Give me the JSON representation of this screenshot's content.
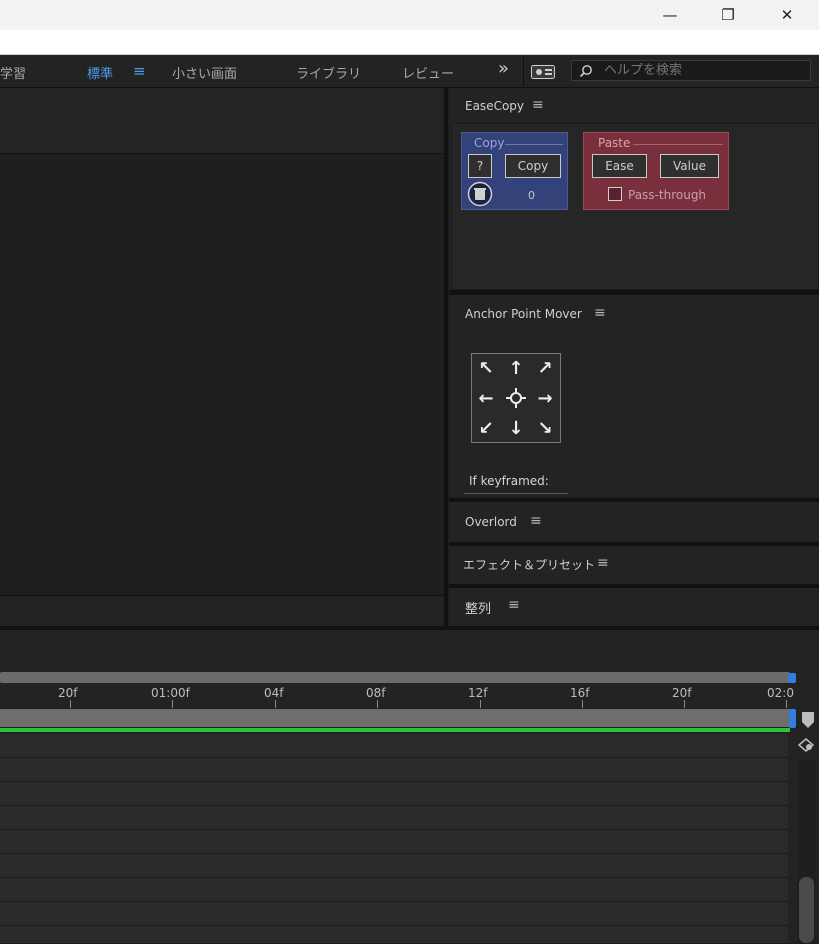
{
  "window": {
    "minimize_glyph": "—",
    "restore_glyph": "❐",
    "close_glyph": "✕"
  },
  "workspaces": [
    {
      "label": "学習",
      "active": false
    },
    {
      "label": "標準",
      "active": true
    },
    {
      "label": "小さい画面",
      "active": false
    },
    {
      "label": "ライブラリ",
      "active": false
    },
    {
      "label": "レビュー",
      "active": false
    }
  ],
  "workspace_menu_glyph": "≡",
  "overflow_glyph": "»",
  "search": {
    "placeholder": "ヘルプを検索"
  },
  "panels": {
    "easecopy": {
      "title": "EaseCopy",
      "copy_group": {
        "legend": "Copy",
        "help_label": "?",
        "copy_label": "Copy",
        "count": "0"
      },
      "paste_group": {
        "legend": "Paste",
        "ease_label": "Ease",
        "value_label": "Value",
        "passthrough_label": "Pass-through"
      }
    },
    "anchor": {
      "title": "Anchor Point Mover",
      "if_keyframed_label": "If keyframed:"
    },
    "overlord": {
      "title": "Overlord"
    },
    "effects": {
      "title": "エフェクト＆プリセット"
    },
    "align": {
      "title": "整列"
    }
  },
  "panel_menu_glyph": "≡",
  "timeline": {
    "ticks": [
      "20f",
      "01:00f",
      "04f",
      "08f",
      "12f",
      "16f",
      "20f",
      "02:0"
    ]
  },
  "colors": {
    "accent_blue": "#4c9bf0",
    "copy_panel": "#34427a",
    "paste_panel": "#7a2f3d",
    "work_area_green": "#2ec23a"
  }
}
